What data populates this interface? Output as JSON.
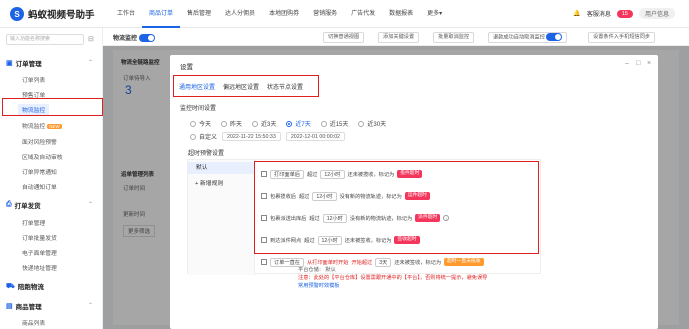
{
  "app": {
    "logo_char": "S",
    "title": "蚂蚁视频号助手"
  },
  "nav": [
    "工作台",
    "商品订单",
    "售后管理",
    "达人分佣员",
    "本地团购券",
    "营销服务",
    "广告代发",
    "数据报表",
    "更多▾"
  ],
  "top_right": {
    "message": "客服消息",
    "count": "15",
    "user": "用户信息"
  },
  "sidebar": {
    "search_placeholder": "输入功能名称搜索",
    "sections": [
      {
        "label": "订单管理",
        "items": [
          "订单列表",
          "预售订单",
          "物流监控",
          "物流监控",
          "面对风险预警",
          "区域及自动审核",
          "订单异常通知",
          "自动通知订单"
        ],
        "new_tag": "NEW"
      },
      {
        "label": "打单发货",
        "items": [
          "打单管理",
          "订单批量发货",
          "电子面单管理",
          "快递地址管理"
        ]
      },
      {
        "label": "陪跑物流"
      },
      {
        "label": "商品管理",
        "items": [
          "商品列表"
        ]
      }
    ]
  },
  "main": {
    "title": "物流监控",
    "buttons": [
      "切换普通视图",
      "添加关键设置",
      "批量取消监控",
      "退款成功自动取消监控",
      "设置条件入手机短信同步"
    ],
    "bg": {
      "panel_title": "物流全链路监控",
      "stat_label": "订单待导入",
      "stat_value": "3",
      "list_title": "运单管理列表",
      "date_label": "订单时间",
      "filter": "更多筛选",
      "time_label": "更新时间"
    }
  },
  "modal": {
    "title": "设置",
    "tabs": [
      "通用地区设置",
      "偏远地区设置",
      "状态节点设置"
    ],
    "monitor_label": "监控时间设置",
    "radios": [
      "今天",
      "昨天",
      "近3天",
      "近7天",
      "近15天",
      "近30天"
    ],
    "selected_radio": "近7天",
    "custom_label": "自定义",
    "date_from": "2022-11-22 15:50:33",
    "date_to": "2022-12-01 00:00:02",
    "rules_label": "超时预警设置",
    "left": {
      "default": "默认",
      "add": "新增规则"
    },
    "rules": [
      {
        "a": "打印面单后",
        "b": "超过",
        "c": "12小时",
        "d": "还未被揽收，标记为",
        "tag": "揽件超时",
        "tag_color": "#f5365c"
      },
      {
        "a": "包裹揽收后",
        "b": "超过",
        "c": "12小时",
        "d": "没有新的物流轨迹，标记为",
        "tag": "运件超时",
        "tag_color": "#f5365c"
      },
      {
        "a": "包裹派送出库后",
        "b": "超过",
        "c": "12小时",
        "d": "没有新的物流轨迹，标记为",
        "tag": "派件超时",
        "tag_color": "#f5365c"
      },
      {
        "a": "到达派件网点",
        "b": "超过",
        "c": "12小时",
        "d": "还未被签收，标记为",
        "tag": "签收超时",
        "tag_color": "#f5365c"
      },
      {
        "a": "订单一直在",
        "b": "",
        "c": "从打印面单时开始",
        "d": "开始超过",
        "e": "3天",
        "f": "还未被签收，标记为",
        "tag": "超时一直未揽收",
        "tag_color": "#ff9a2e"
      }
    ],
    "platform": "平台仓储：  默认",
    "note1": "注意：此处的【平台仓库】设置需跟开通中的【平台】，否则将统一提示，避免误导",
    "note2": "常用预警时效模板"
  }
}
